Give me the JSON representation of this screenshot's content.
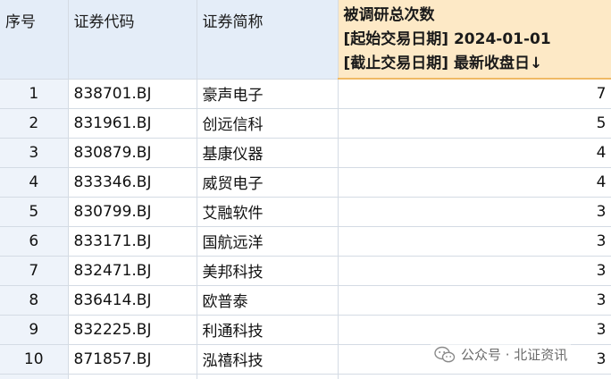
{
  "headers": {
    "index": "序号",
    "code": "证券代码",
    "name": "证券简称",
    "count_line1": "被调研总次数",
    "count_line2": "[起始交易日期] 2024-01-01",
    "count_line3": "[截止交易日期] 最新收盘日↓"
  },
  "rows": [
    {
      "index": "1",
      "code": "838701.BJ",
      "name": "豪声电子",
      "count": "7"
    },
    {
      "index": "2",
      "code": "831961.BJ",
      "name": "创远信科",
      "count": "5"
    },
    {
      "index": "3",
      "code": "830879.BJ",
      "name": "基康仪器",
      "count": "4"
    },
    {
      "index": "4",
      "code": "833346.BJ",
      "name": "威贸电子",
      "count": "4"
    },
    {
      "index": "5",
      "code": "830799.BJ",
      "name": "艾融软件",
      "count": "3"
    },
    {
      "index": "6",
      "code": "833171.BJ",
      "name": "国航远洋",
      "count": "3"
    },
    {
      "index": "7",
      "code": "832471.BJ",
      "name": "美邦科技",
      "count": "3"
    },
    {
      "index": "8",
      "code": "836414.BJ",
      "name": "欧普泰",
      "count": "3"
    },
    {
      "index": "9",
      "code": "832225.BJ",
      "name": "利通科技",
      "count": "3"
    },
    {
      "index": "10",
      "code": "871857.BJ",
      "name": "泓禧科技",
      "count": "3"
    }
  ],
  "watermark": {
    "icon": "wechat-icon",
    "text": "公众号 · 北证资讯"
  },
  "colors": {
    "header_bg": "#e4edf8",
    "sorted_header_bg": "#fde9c6",
    "grid_line": "#d4dbe4"
  }
}
